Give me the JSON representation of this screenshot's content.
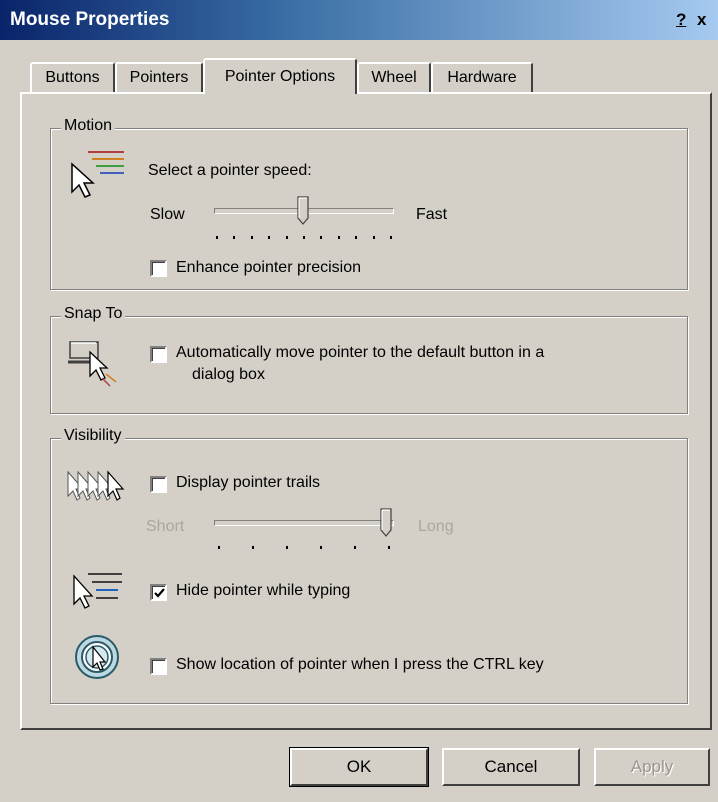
{
  "window": {
    "title": "Mouse Properties",
    "help_glyph": "?",
    "close_glyph": "x"
  },
  "tabs": [
    {
      "label": "Buttons",
      "active": false
    },
    {
      "label": "Pointers",
      "active": false
    },
    {
      "label": "Pointer Options",
      "active": true
    },
    {
      "label": "Wheel",
      "active": false
    },
    {
      "label": "Hardware",
      "active": false
    }
  ],
  "motion": {
    "legend": "Motion",
    "speed_prompt": "Select a pointer speed:",
    "slow_label": "Slow",
    "fast_label": "Fast",
    "speed_level": 0.5,
    "enhance_precision": {
      "label": "Enhance pointer precision",
      "checked": false
    }
  },
  "snap_to": {
    "legend": "Snap To",
    "auto_move": {
      "label_line1": "Automatically move pointer to the default button in a",
      "label_line2": "dialog box",
      "checked": false
    }
  },
  "visibility": {
    "legend": "Visibility",
    "trails": {
      "label": "Display pointer trails",
      "checked": false
    },
    "short_label": "Short",
    "long_label": "Long",
    "trail_level": 1.0,
    "hide_typing": {
      "label": "Hide pointer while typing",
      "checked": true
    },
    "show_location": {
      "label": "Show location of pointer when I press the CTRL key",
      "checked": false
    }
  },
  "buttons": {
    "ok": "OK",
    "cancel": "Cancel",
    "apply": "Apply"
  }
}
